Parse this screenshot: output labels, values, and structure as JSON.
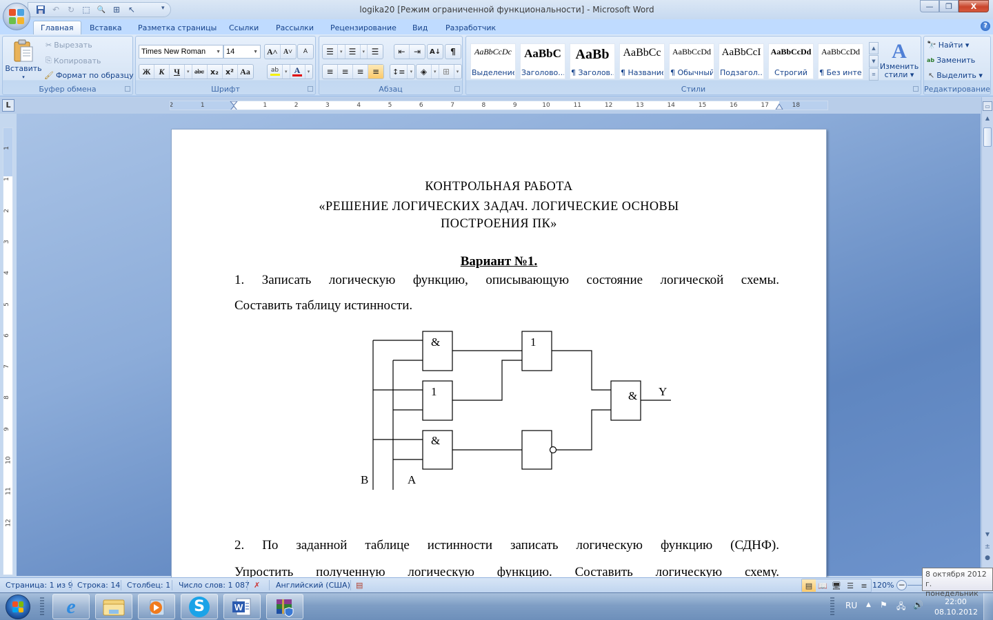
{
  "window": {
    "title": "logika20 [Режим ограниченной функциональности] - Microsoft Word",
    "controls": {
      "minimize": "—",
      "restore": "❐",
      "close": "X"
    }
  },
  "quick_access": {
    "items": [
      {
        "name": "save",
        "glyph": "💾"
      },
      {
        "name": "undo",
        "glyph": "↶"
      },
      {
        "name": "redo",
        "glyph": "↻"
      },
      {
        "name": "select-objects",
        "glyph": "⬚"
      },
      {
        "name": "print-preview",
        "glyph": "🔍"
      },
      {
        "name": "group",
        "glyph": "⊞"
      },
      {
        "name": "pointer",
        "glyph": "↖"
      }
    ],
    "more": "▾"
  },
  "tabs": [
    {
      "label": "Главная",
      "active": true
    },
    {
      "label": "Вставка"
    },
    {
      "label": "Разметка страницы"
    },
    {
      "label": "Ссылки"
    },
    {
      "label": "Рассылки"
    },
    {
      "label": "Рецензирование"
    },
    {
      "label": "Вид"
    },
    {
      "label": "Разработчик"
    }
  ],
  "help": "?",
  "ribbon": {
    "clipboard": {
      "label": "Буфер обмена",
      "paste": "Вставить",
      "cut": "Вырезать",
      "copy": "Копировать",
      "format_painter": "Формат по образцу"
    },
    "font": {
      "label": "Шрифт",
      "font_name": "Times New Roman",
      "font_size": "14",
      "grow": "A˄",
      "shrink": "A˅",
      "clear": "A",
      "bold": "Ж",
      "italic": "К",
      "underline": "Ч",
      "strike": "abc",
      "subscript": "x₂",
      "superscript": "x²",
      "case": "Aa",
      "highlight": "ab",
      "font_color": "A",
      "font_color_hex": "#e00000",
      "highlight_hex": "#f5f000"
    },
    "paragraph": {
      "label": "Абзац",
      "bullets": "☰",
      "numbering": "☰",
      "multilevel": "☰",
      "decrease_indent": "⇤",
      "increase_indent": "⇥",
      "sort": "A↓",
      "show_marks": "¶",
      "align_left": "≡",
      "align_center": "≡",
      "align_right": "≡",
      "justify": "≡",
      "line_spacing": "↕≡",
      "shading": "◈",
      "borders": "⊞",
      "justify_active": true
    },
    "styles": {
      "label": "Стили",
      "items": [
        {
          "preview": "AaBbCcDc",
          "name": "Выделение"
        },
        {
          "preview": "AaBbC",
          "name": "Заголово..."
        },
        {
          "preview": "AaBb",
          "name": "¶ Заголов..."
        },
        {
          "preview": "AaBbCc",
          "name": "¶ Название"
        },
        {
          "preview": "AaBbCcDd",
          "name": "¶ Обычный"
        },
        {
          "preview": "AaBbCcI",
          "name": "Подзагол..."
        },
        {
          "preview": "AaBbCcDd",
          "name": "Строгий"
        },
        {
          "preview": "AaBbCcDd",
          "name": "¶ Без инте..."
        }
      ],
      "change_styles_line1": "Изменить",
      "change_styles_line2": "стили ▾"
    },
    "editing": {
      "label": "Редактирование",
      "find": "Найти ▾",
      "replace": "Заменить",
      "select": "Выделить ▾"
    }
  },
  "ruler": {
    "tab_selector": "L",
    "left_numbers": [
      "2",
      "1"
    ],
    "numbers": [
      "1",
      "2",
      "3",
      "4",
      "5",
      "6",
      "7",
      "8",
      "9",
      "10",
      "11",
      "12",
      "13",
      "14",
      "15",
      "16",
      "17",
      "18"
    ],
    "vertical_numbers": [
      "1",
      "1",
      "2",
      "3",
      "4",
      "5",
      "6",
      "7",
      "8",
      "9",
      "10",
      "11",
      "12"
    ]
  },
  "document": {
    "title_line1": "КОНТРОЛЬНАЯ РАБОТА",
    "title_line2": "«РЕШЕНИЕ ЛОГИЧЕСКИХ ЗАДАЧ. ЛОГИЧЕСКИЕ ОСНОВЫ",
    "title_line3": "ПОСТРОЕНИЯ ПК»",
    "variant": "Вариант №1.",
    "task1_line1": "1. Записать логическую функцию, описывающую состояние логической схемы.",
    "task1_line2": "Составить таблицу истинности.",
    "task2_line1": "2. По заданной таблице истинности записать логическую функцию (СДНФ).",
    "task2_line2": "Упростить полученную логическую функцию. Составить логическую схему.",
    "circuit": {
      "inputs": [
        "B",
        "A"
      ],
      "output": "Y",
      "gates": [
        {
          "id": "g1",
          "type": "AND",
          "label": "&",
          "inputs": [
            "B",
            "A"
          ]
        },
        {
          "id": "g2",
          "type": "OR",
          "label": "1",
          "inputs": [
            "B",
            "A"
          ]
        },
        {
          "id": "g3",
          "type": "AND",
          "label": "&",
          "inputs": [
            "B",
            "A"
          ]
        },
        {
          "id": "g4",
          "type": "OR",
          "label": "1",
          "inputs": [
            "g1",
            "g2"
          ]
        },
        {
          "id": "g5",
          "type": "NOT",
          "label": "",
          "inputs": [
            "g3"
          ]
        },
        {
          "id": "g6",
          "type": "AND",
          "label": "&",
          "inputs": [
            "g4",
            "g5"
          ]
        }
      ]
    }
  },
  "status": {
    "page": "Страница: 1 из 9",
    "line": "Строка: 14",
    "column": "Столбец: 1",
    "words": "Число слов: 1 087",
    "language": "Английский (США)",
    "zoom": "120%",
    "view_active": "print-layout"
  },
  "tooltip": {
    "line1": "8 октября 2012 г.",
    "line2": "понедельник"
  },
  "taskbar": {
    "apps": [
      {
        "name": "internet-explorer"
      },
      {
        "name": "windows-explorer"
      },
      {
        "name": "media-player"
      },
      {
        "name": "skype"
      },
      {
        "name": "microsoft-word"
      },
      {
        "name": "winrar"
      }
    ],
    "language": "RU",
    "time": "22:00",
    "date": "08.10.2012"
  }
}
